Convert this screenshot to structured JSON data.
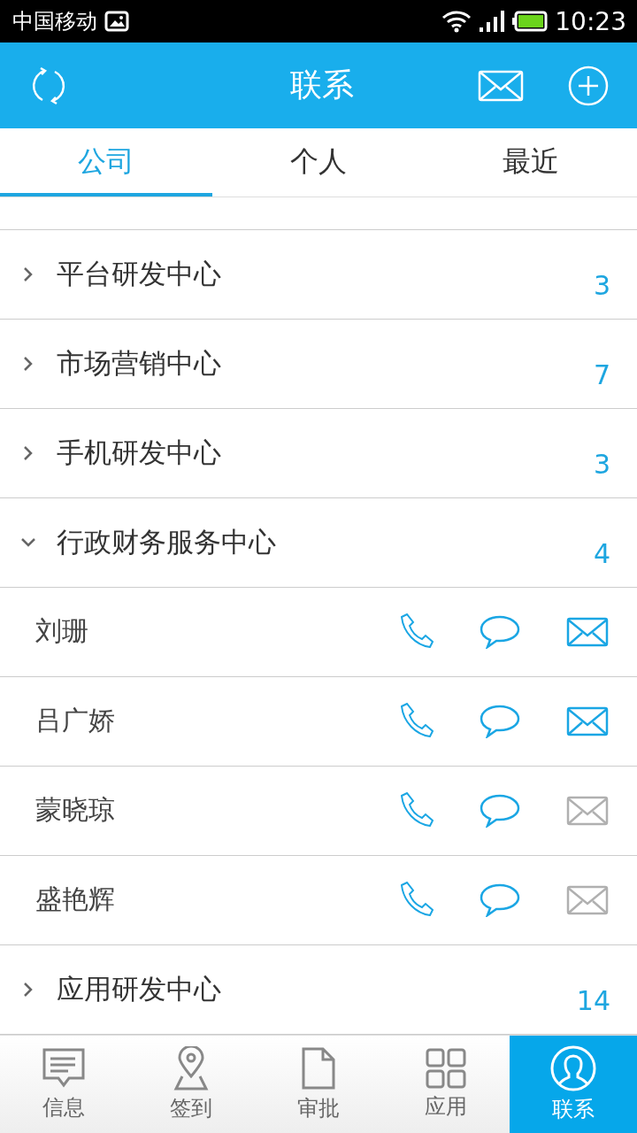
{
  "status_bar": {
    "carrier": "中国移动",
    "time": "10:23"
  },
  "header": {
    "title": "联系"
  },
  "tabs": [
    {
      "label": "公司",
      "selected": true
    },
    {
      "label": "个人",
      "selected": false
    },
    {
      "label": "最近",
      "selected": false
    }
  ],
  "groups": [
    {
      "name": "平台研发中心",
      "count": "3",
      "expanded": false
    },
    {
      "name": "市场营销中心",
      "count": "7",
      "expanded": false
    },
    {
      "name": "手机研发中心",
      "count": "3",
      "expanded": false
    },
    {
      "name": "行政财务服务中心",
      "count": "4",
      "expanded": true,
      "members": [
        {
          "name": "刘珊",
          "email_enabled": true
        },
        {
          "name": "吕广娇",
          "email_enabled": true
        },
        {
          "name": "蒙晓琼",
          "email_enabled": false
        },
        {
          "name": "盛艳辉",
          "email_enabled": false
        }
      ]
    },
    {
      "name": "应用研发中心",
      "count": "14",
      "expanded": false
    }
  ],
  "bottom_nav": [
    {
      "label": "信息",
      "kind": "message",
      "selected": false
    },
    {
      "label": "签到",
      "kind": "location",
      "selected": false
    },
    {
      "label": "审批",
      "kind": "document",
      "selected": false
    },
    {
      "label": "应用",
      "kind": "apps",
      "selected": false
    },
    {
      "label": "联系",
      "kind": "contact",
      "selected": true
    }
  ]
}
